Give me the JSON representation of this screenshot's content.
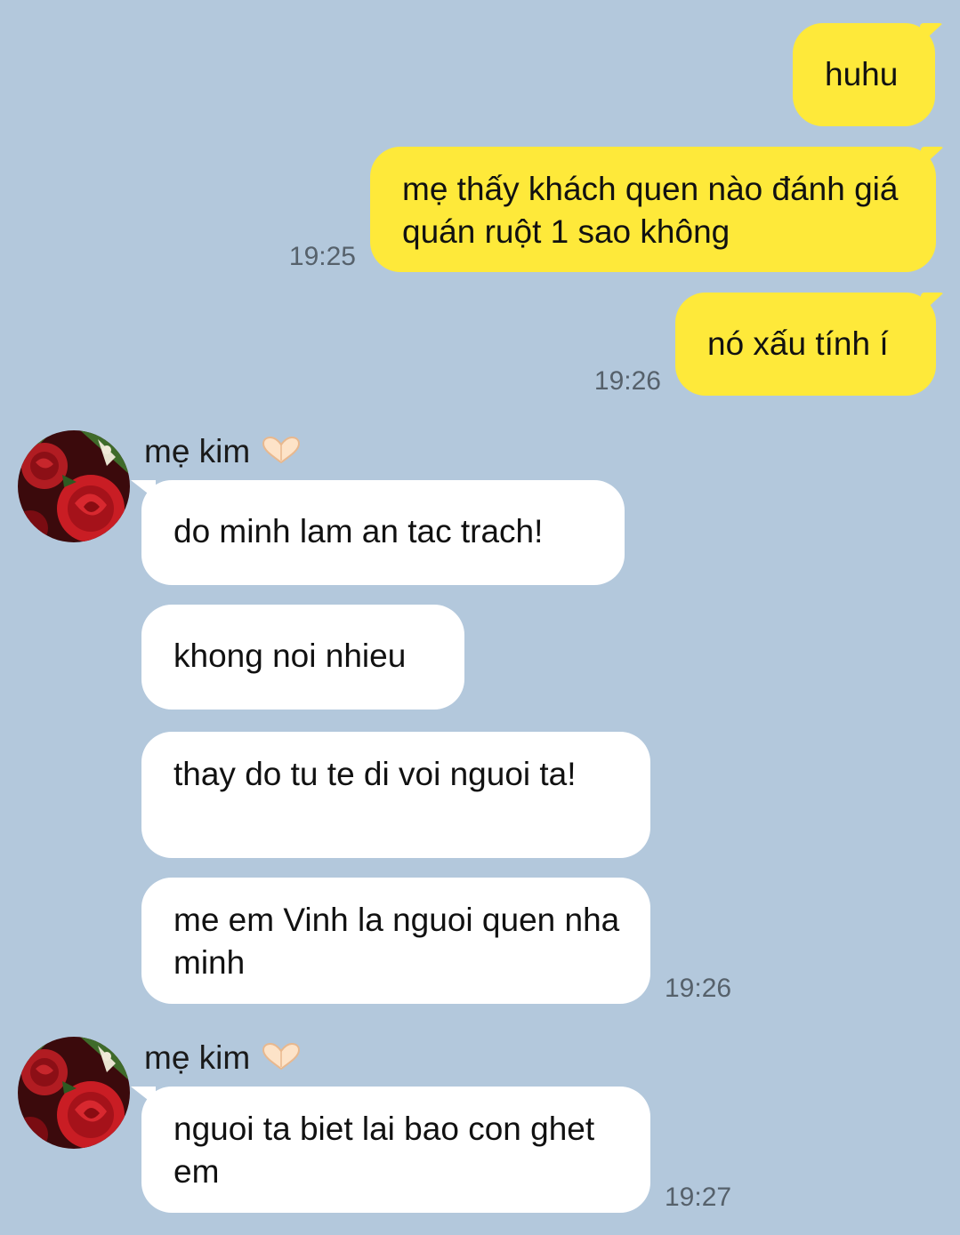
{
  "sent_messages": [
    {
      "text": "huhu",
      "time": ""
    },
    {
      "text": "mẹ thấy khách quen nào đánh giá quán ruột 1 sao không",
      "time": "19:25"
    },
    {
      "text": "nó xấu tính í",
      "time": "19:26"
    }
  ],
  "groups": [
    {
      "sender": "mẹ kim",
      "messages": [
        {
          "text": "do minh lam an tac trach!"
        },
        {
          "text": "khong noi nhieu"
        },
        {
          "text": "thay do tu te di voi nguoi ta!"
        },
        {
          "text": "me em Vinh la nguoi quen nha minh"
        }
      ],
      "time": "19:26"
    },
    {
      "sender": "mẹ kim",
      "messages": [
        {
          "text": "nguoi ta biet lai bao con ghet em"
        }
      ],
      "time": "19:27"
    }
  ],
  "colors": {
    "background": "#b3c8dc",
    "sent_bubble": "#fee93a",
    "received_bubble": "#ffffff",
    "timestamp": "#56616b"
  },
  "icons": {
    "sender_heart": "heart-hands-emoji",
    "avatar": "red-roses-photo"
  }
}
